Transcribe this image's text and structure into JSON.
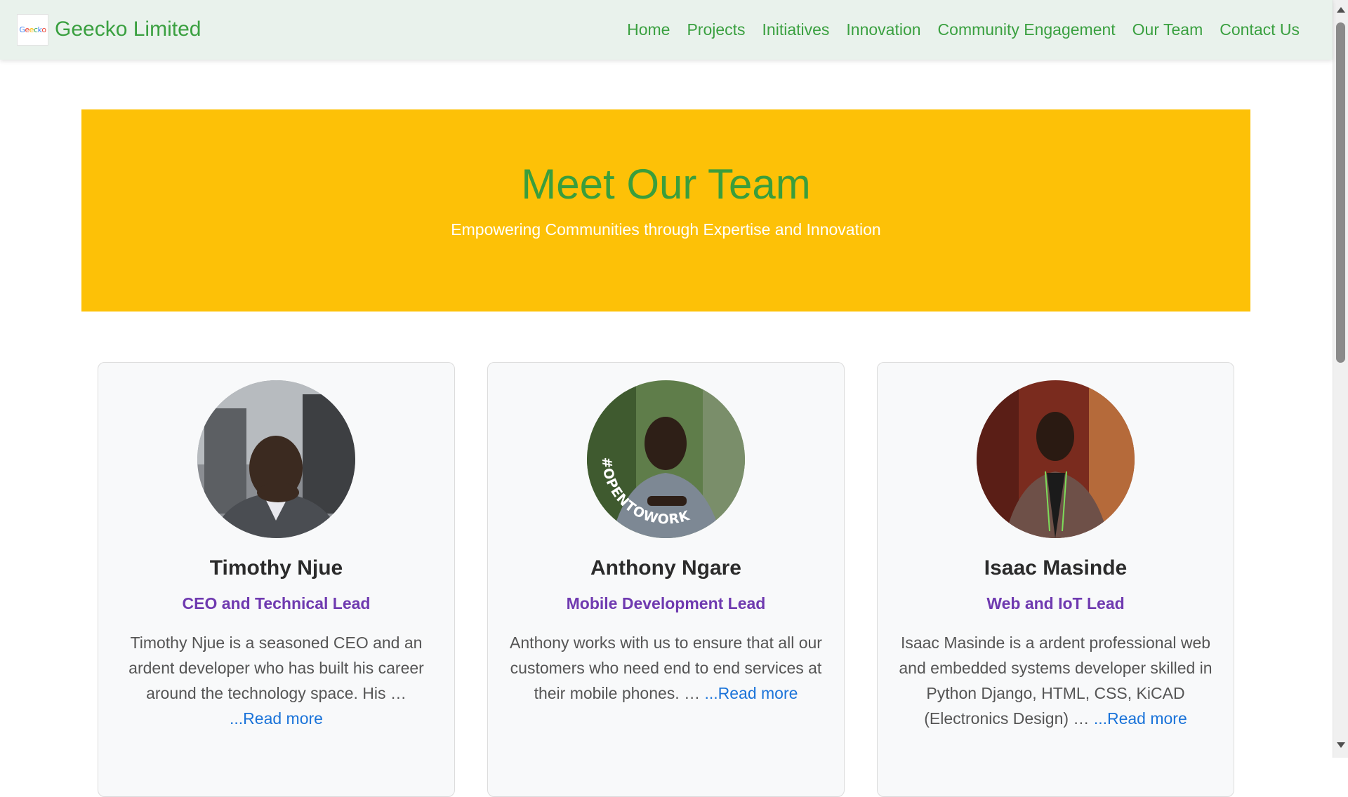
{
  "brand": {
    "logo_text": "Geecko",
    "name": "Geecko Limited"
  },
  "nav": {
    "items": [
      {
        "label": "Home"
      },
      {
        "label": "Projects"
      },
      {
        "label": "Initiatives"
      },
      {
        "label": "Innovation"
      },
      {
        "label": "Community Engagement"
      },
      {
        "label": "Our Team"
      },
      {
        "label": "Contact Us"
      }
    ]
  },
  "hero": {
    "title": "Meet Our Team",
    "subtitle": "Empowering Communities through Expertise and Innovation"
  },
  "team": [
    {
      "name": "Timothy Njue",
      "role": "CEO and Technical Lead",
      "bio": "Timothy Njue is a seasoned CEO and an ardent developer who has built his career around the technology space. His … ",
      "read_more": "...Read more",
      "photo_badge": ""
    },
    {
      "name": "Anthony Ngare",
      "role": "Mobile Development Lead",
      "bio": "Anthony works with us to ensure that all our customers who need end to end services at their mobile phones. … ",
      "read_more": "...Read more",
      "photo_badge": "#OPENTOWORK"
    },
    {
      "name": "Isaac Masinde",
      "role": "Web and IoT Lead",
      "bio": "Isaac Masinde is a ardent professional web and embedded systems developer skilled in Python Django, HTML, CSS, KiCAD (Electronics Design) … ",
      "read_more": "...Read more",
      "photo_badge": ""
    }
  ],
  "colors": {
    "navbar_bg": "#e9f2ec",
    "brand_green": "#3aa040",
    "hero_bg": "#fdc107",
    "role_purple": "#6f3ab0",
    "link_blue": "#1a73d9"
  }
}
